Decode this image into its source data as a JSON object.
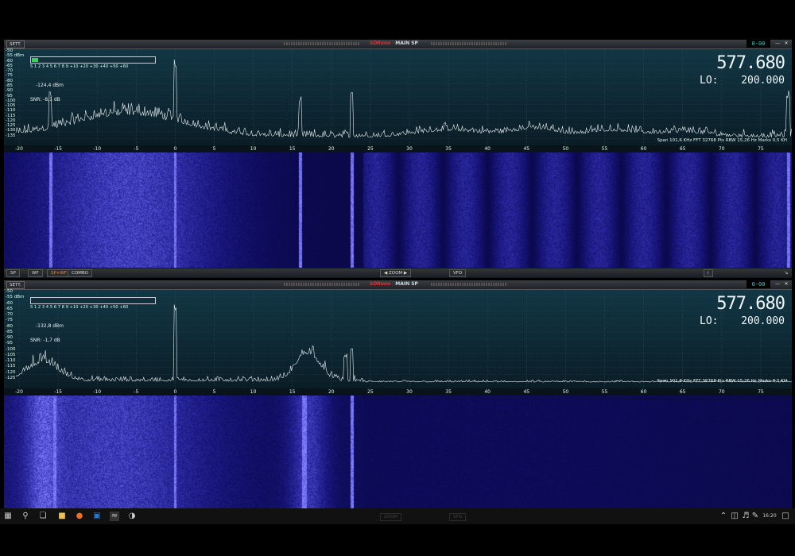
{
  "panels": [
    {
      "id": "top",
      "title": {
        "brand": "SDRuno",
        "window": "MAIN SP"
      },
      "sett_label": "SETT.",
      "counter": "0-00",
      "db_labels": [
        "-50",
        "-55 dBm",
        "-60",
        "-65",
        "-70",
        "-75",
        "-80",
        "-85",
        "-90",
        "-95",
        "-100",
        "-105",
        "-110",
        "-115",
        "-120",
        "-125",
        "-130",
        "-135"
      ],
      "smeter_scale": "S   1   2   3   4   5   6   7   8   9   +10  +20  +30  +40  +50  +60",
      "smeter_level": 0.05,
      "power": "-124,4 dBm",
      "snr": "SNR: -8,1 dB",
      "frequency": "577.680",
      "lo_label": "LO:",
      "lo_value": "200.000",
      "info": "Span 101,6 KHz   FFT 32768 Pts   RBW 15,26 Hz   Marks 0,5 KH",
      "x_ticks": [
        "-20",
        "-15",
        "-10",
        "-5",
        "0",
        "5",
        "10",
        "15",
        "20",
        "25",
        "30",
        "35",
        "40",
        "45",
        "50",
        "55",
        "60",
        "65",
        "70",
        "75"
      ]
    },
    {
      "id": "bottom",
      "title": {
        "brand": "SDRuno",
        "window": "MAIN SP"
      },
      "sett_label": "SETT.",
      "counter": "0-00",
      "db_labels": [
        "-50",
        "-55 dBm",
        "-60",
        "-65",
        "-70",
        "-75",
        "-80",
        "-85",
        "-90",
        "-95",
        "-100",
        "-105",
        "-110",
        "-115",
        "-120",
        "-125"
      ],
      "smeter_scale": "S   1   2   3   4   5   6   7   8   9   +10  +20  +30  +40  +50  +60",
      "smeter_level": 0.0,
      "power": "-132,8 dBm",
      "snr": "SNR: -1,7 dB",
      "frequency": "577.680",
      "lo_label": "LO:",
      "lo_value": "200.000",
      "info": "Span 101,6 KHz   FFT 32768 Pts   RBW 15,26 Hz   Marks 0,5 KH",
      "x_ticks": [
        "-20",
        "-15",
        "-10",
        "-5",
        "0",
        "5",
        "10",
        "15",
        "20",
        "25",
        "30",
        "35",
        "40",
        "45",
        "50",
        "55",
        "60",
        "65",
        "70",
        "75"
      ]
    }
  ],
  "bottombar": {
    "sp": "SP",
    "wf": "WF",
    "spwf": "SP+WF",
    "combo": "COMBO",
    "zoom": "ZOOM",
    "vfo": "VFO",
    "info_btn": "i"
  },
  "taskbar": {
    "time": "16:20"
  },
  "colors": {
    "waterfall_bg": "#0a0a3a",
    "waterfall_bright": "#8d8df5",
    "trace": "#e8eef0",
    "accent_active": "#e88a2a",
    "counter": "#2fd0d0"
  }
}
